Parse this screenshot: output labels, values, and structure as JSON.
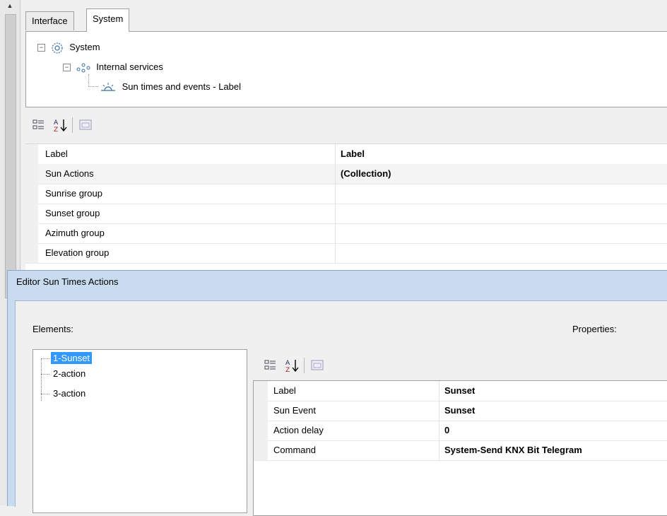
{
  "top_panel": {
    "tabs": [
      {
        "label": "Interface",
        "active": false
      },
      {
        "label": "System",
        "active": true
      }
    ],
    "tree": [
      {
        "label": "System",
        "icon": "gear-icon",
        "expander": "−"
      },
      {
        "label": "Internal services",
        "icon": "services-icon",
        "expander": "−"
      },
      {
        "label": "Sun times and events - Label",
        "icon": "sun-icon"
      }
    ],
    "toolbar": [
      "categorized-icon",
      "sort-alpha-icon",
      "property-pages-icon"
    ],
    "properties": [
      {
        "name": "Label",
        "value": "Label"
      },
      {
        "name": "Sun Actions",
        "value": "(Collection)"
      },
      {
        "name": "Sunrise group",
        "value": ""
      },
      {
        "name": "Sunset group",
        "value": ""
      },
      {
        "name": "Azimuth group",
        "value": ""
      },
      {
        "name": "Elevation group",
        "value": ""
      }
    ]
  },
  "dialog": {
    "title": "Editor Sun Times Actions",
    "elements_label": "Elements:",
    "properties_label": "Properties:",
    "elements": [
      "1-Sunset",
      "2-action",
      "3-action"
    ],
    "selected_element": "1-Sunset",
    "properties": [
      {
        "name": "Label",
        "value": "Sunset"
      },
      {
        "name": "Sun Event",
        "value": "Sunset"
      },
      {
        "name": "Action delay",
        "value": "0"
      },
      {
        "name": "Command",
        "value": "System-Send KNX Bit Telegram"
      }
    ]
  },
  "colors": {
    "selection": "#3399ff",
    "dialog_frame": "#c8dbef"
  }
}
